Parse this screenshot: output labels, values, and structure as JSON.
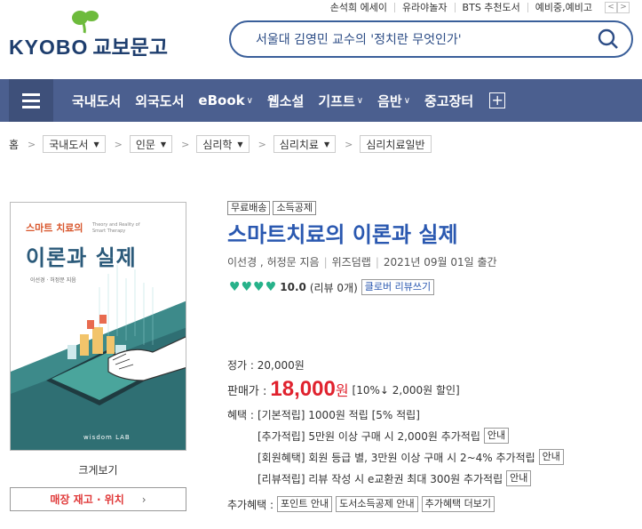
{
  "top_links": [
    "손석희 에세이",
    "유라야놀자",
    "BTS 추천도서",
    "예비중,예비고"
  ],
  "top_arrows": [
    "<",
    ">"
  ],
  "logo": {
    "text_en": "KYOBO",
    "text_ko": "교보문고"
  },
  "search": {
    "query": "서울대 김영민 교수의 '정치란 무엇인가'"
  },
  "nav": {
    "items": [
      {
        "label": "국내도서",
        "chevron": ""
      },
      {
        "label": "외국도서",
        "chevron": ""
      },
      {
        "label": "eBook",
        "chevron": "∨"
      },
      {
        "label": "웹소설",
        "chevron": ""
      },
      {
        "label": "기프트",
        "chevron": "∨"
      },
      {
        "label": "음반",
        "chevron": "∨"
      },
      {
        "label": "중고장터",
        "chevron": ""
      }
    ],
    "plus": "+"
  },
  "breadcrumb": {
    "home": "홈",
    "sep": ">",
    "items": [
      "국내도서",
      "인문",
      "심리학",
      "심리치료",
      "심리치료일반"
    ]
  },
  "book": {
    "cover": {
      "title_small": "스마트 치료의",
      "title_big": "이론과 실제",
      "title_en": "Theory and Reality of Smart Therapy",
      "authors": "이선경 · 허정문 지음",
      "publisher_logo": "wisdom LAB"
    },
    "enlarge_label": "크게보기",
    "store_label": "매장 재고 · 위치",
    "store_chevron": "›",
    "tags": [
      "무료배송",
      "소득공제"
    ],
    "title": "스마트치료의 이론과 실제",
    "authors": "이선경 , 허정문 지음",
    "publisher": "위즈덤랩",
    "date": "2021년 09월 01일 출간",
    "rating": {
      "hearts": 4,
      "score": "10.0",
      "reviews": "(리뷰 0개)",
      "button": "클로버 리뷰쓰기"
    },
    "list_price": "정가 : 20,000원",
    "sale_label": "판매가 :",
    "sale_price": "18,000",
    "sale_won": "원",
    "discount": "[10%↓ 2,000원 할인]",
    "benefit_label": "혜택 :",
    "benefits": [
      {
        "text": "[기본적립] 1000원 적립 [5% 적립]",
        "button": ""
      },
      {
        "text": "[추가적립] 5만원 이상 구매 시 2,000원 추가적립",
        "button": "안내"
      },
      {
        "text": "[회원혜택] 회원 등급 별, 3만원 이상 구매 시 2~4% 추가적립",
        "button": "안내"
      },
      {
        "text": "[리뷰적립] 리뷰 작성 시 e교환권 최대 300원 추가적립",
        "button": "안내"
      }
    ],
    "extra_label": "추가혜택 :",
    "extra_buttons": [
      "포인트 안내",
      "도서소득공제 안내",
      "추가혜택 더보기"
    ]
  },
  "colors": {
    "navbar": "#4b5f8f",
    "accent_blue": "#2a58b0",
    "price_red": "#e0222e",
    "heart_green": "#27b28a"
  }
}
